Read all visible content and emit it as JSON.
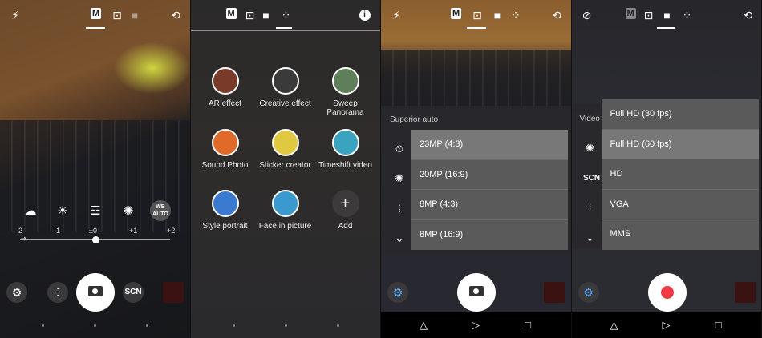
{
  "screen1": {
    "top_modes": [
      "M"
    ],
    "exposure_scale": [
      "-2",
      "-1",
      "±0",
      "+1",
      "+2"
    ],
    "wb_auto_label": "WB\nAUTO",
    "scn_label": "SCN",
    "icons": {
      "flash": "flash-off-icon",
      "settings": "gear-icon",
      "adjust": "sliders-icon"
    }
  },
  "screen2": {
    "top_mode_label": "M",
    "info_icon": "i",
    "modes": [
      {
        "label": "AR effect",
        "icon_color": "#7a3a2a"
      },
      {
        "label": "Creative effect",
        "icon_color": "#3a3a3a"
      },
      {
        "label": "Sweep\nPanorama",
        "icon_color": "#5f7f5a"
      },
      {
        "label": "Sound Photo",
        "icon_color": "#e06a2a"
      },
      {
        "label": "Sticker creator",
        "icon_color": "#e0c940"
      },
      {
        "label": "Timeshift video",
        "icon_color": "#3aa3c0"
      },
      {
        "label": "Style portrait",
        "icon_color": "#3a7ad0"
      },
      {
        "label": "Face in picture",
        "icon_color": "#3a9acf"
      },
      {
        "label": "Add",
        "icon_color": "#3c3a3a"
      }
    ]
  },
  "screen3": {
    "top_mode_label": "M",
    "panel_title": "Superior auto",
    "menu": [
      "23MP (4:3)",
      "20MP (16:9)",
      "8MP (4:3)",
      "8MP (16:9)"
    ],
    "selected_index": 0
  },
  "screen4": {
    "top_mode_label": "M",
    "side_label": "Video",
    "scn_label": "SCN",
    "menu": [
      "Full HD (30 fps)",
      "Full HD (60 fps)",
      "HD",
      "VGA",
      "MMS"
    ],
    "selected_index": 1
  },
  "nav": {
    "back": "back-icon",
    "home": "home-icon",
    "recents": "recents-icon"
  }
}
